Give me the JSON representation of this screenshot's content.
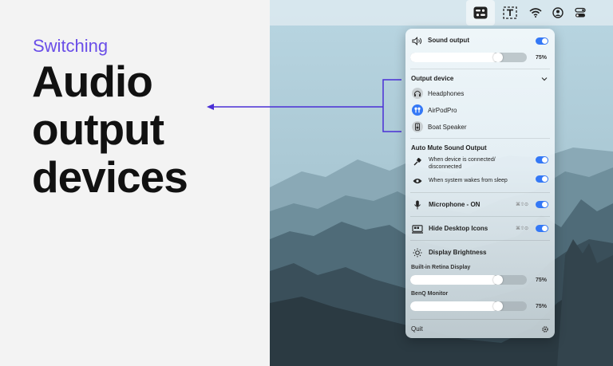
{
  "promo": {
    "kicker": "Switching",
    "headline_line1": "Audio",
    "headline_line2": "output",
    "headline_line3": "devices"
  },
  "colors": {
    "accent_purple": "#6a4ee8",
    "toggle_blue": "#3478f6",
    "arrow": "#4a2fd6"
  },
  "menubar": {
    "icons": [
      "control-panel-icon",
      "text-capture-icon",
      "wifi-icon",
      "user-account-icon",
      "control-center-icon"
    ]
  },
  "popover": {
    "sound_output": {
      "label": "Sound output",
      "enabled": true,
      "volume": 0.75,
      "volume_text": "75%"
    },
    "output_device": {
      "header": "Output device",
      "devices": [
        {
          "name": "Headphones",
          "icon": "headphones-icon",
          "selected": false
        },
        {
          "name": "AirPodPro",
          "icon": "airpods-icon",
          "selected": true
        },
        {
          "name": "Boat Speaker",
          "icon": "speaker-icon",
          "selected": false
        }
      ]
    },
    "auto_mute": {
      "header": "Auto Mute Sound Output",
      "opt1_line1": "When device is connected/",
      "opt1_line2": "disconnected",
      "opt1_enabled": true,
      "opt2": "When system wakes from sleep",
      "opt2_enabled": true
    },
    "microphone": {
      "label": "Microphone - ON",
      "shortcut": "⌘⇧⊙",
      "enabled": true
    },
    "desktop_icons": {
      "label": "Hide Desktop Icons",
      "shortcut": "⌘⇧⊙",
      "enabled": true
    },
    "brightness": {
      "header": "Display Brightness",
      "displays": [
        {
          "name": "Built-in Retina Display",
          "level": 0.75,
          "level_text": "75%"
        },
        {
          "name": "BenQ Monitor",
          "level": 0.75,
          "level_text": "75%"
        }
      ]
    },
    "footer": {
      "quit": "Quit"
    }
  }
}
